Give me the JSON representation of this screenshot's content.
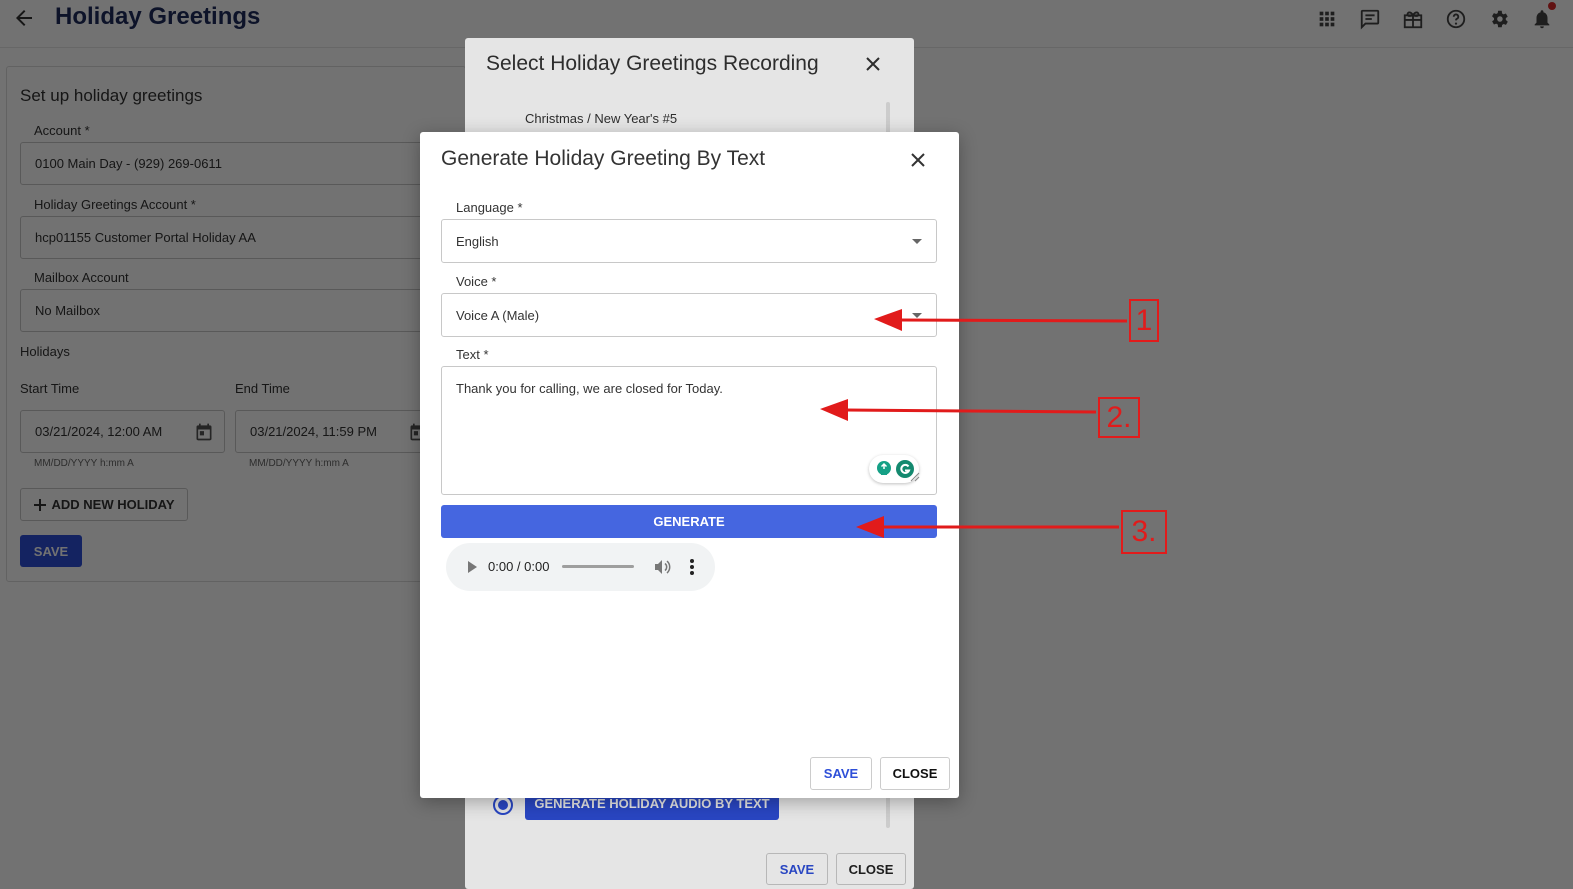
{
  "header": {
    "title": "Holiday Greetings"
  },
  "form": {
    "title": "Set up holiday greetings",
    "account_label": "Account *",
    "account_value": "0100 Main Day - (929) 269-0611",
    "hg_account_label": "Holiday Greetings Account *",
    "hg_account_value": "hcp01155 Customer Portal Holiday AA",
    "mailbox_label": "Mailbox Account",
    "mailbox_value": "No Mailbox",
    "holidays_label": "Holidays",
    "start_label": "Start Time",
    "start_value": "03/21/2024, 12:00 AM",
    "end_label": "End Time",
    "end_value": "03/21/2024, 11:59 PM",
    "date_hint": "MM/DD/YYYY h:mm A",
    "add_label": "ADD NEW HOLIDAY",
    "save_label": "SAVE"
  },
  "dialog1": {
    "title": "Select Holiday Greetings Recording",
    "item": "Christmas / New Year's #5",
    "generate_label": "GENERATE HOLIDAY AUDIO BY TEXT",
    "save_label": "SAVE",
    "close_label": "CLOSE"
  },
  "dialog2": {
    "title": "Generate Holiday Greeting By Text",
    "language_label": "Language *",
    "language_value": "English",
    "voice_label": "Voice *",
    "voice_value": "Voice A (Male)",
    "text_label": "Text *",
    "text_value": "Thank you for calling, we are closed for Today.",
    "generate_label": "GENERATE",
    "player_time": "0:00 / 0:00",
    "save_label": "SAVE",
    "close_label": "CLOSE"
  },
  "annotations": [
    "1",
    "2.",
    "3."
  ],
  "colors": {
    "primary": "#2e4fd8",
    "generate": "#4566e0",
    "title": "#1f2d5c",
    "annotation": "#e11b1b"
  }
}
